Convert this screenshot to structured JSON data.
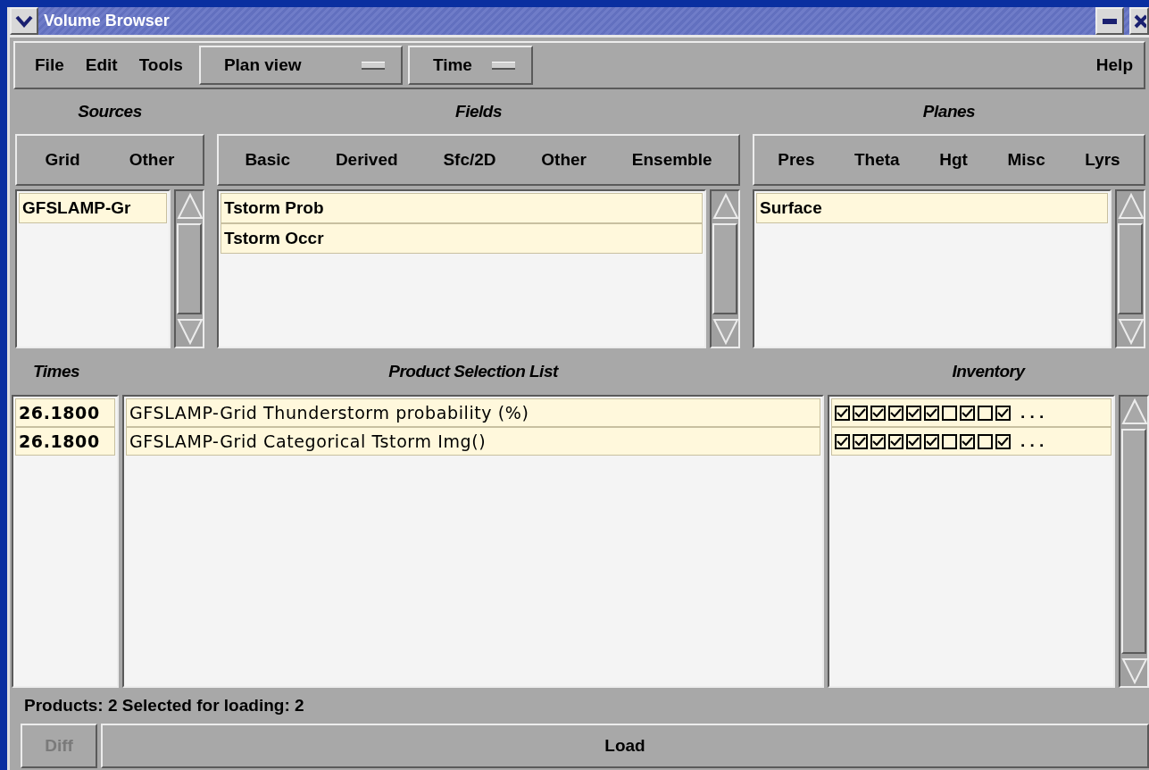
{
  "window": {
    "title": "Volume Browser"
  },
  "menu": [
    "File",
    "Edit",
    "Tools"
  ],
  "dropdowns": [
    "Plan view",
    "Time"
  ],
  "help": "Help",
  "sources": {
    "title": "Sources",
    "tabs": [
      "Grid",
      "Other"
    ],
    "items": [
      {
        "label": "GFSLAMP-Gr",
        "selected": true
      }
    ]
  },
  "fields": {
    "title": "Fields",
    "tabs": [
      "Basic",
      "Derived",
      "Sfc/2D",
      "Other",
      "Ensemble"
    ],
    "items": [
      {
        "label": "Tstorm Prob",
        "selected": true
      },
      {
        "label": "Tstorm Occr",
        "selected": true
      }
    ]
  },
  "planes": {
    "title": "Planes",
    "tabs": [
      "Pres",
      "Theta",
      "Hgt",
      "Misc",
      "Lyrs"
    ],
    "items": [
      {
        "label": "Surface",
        "selected": true
      }
    ]
  },
  "times": {
    "title": "Times",
    "items": [
      {
        "label": "26.1800",
        "selected": true
      },
      {
        "label": "26.1800",
        "selected": true
      }
    ]
  },
  "products": {
    "title": "Product Selection List",
    "items": [
      {
        "label": "GFSLAMP-Grid Thunderstorm probability (%)",
        "selected": true
      },
      {
        "label": "GFSLAMP-Grid Categorical Tstorm Img()",
        "selected": true
      }
    ]
  },
  "inventory": {
    "title": "Inventory",
    "rows": [
      {
        "selected": true,
        "checks": [
          true,
          true,
          true,
          true,
          true,
          true,
          false,
          true,
          false,
          true
        ],
        "more": ". . ."
      },
      {
        "selected": true,
        "checks": [
          true,
          true,
          true,
          true,
          true,
          true,
          false,
          true,
          false,
          true
        ],
        "more": ". . ."
      }
    ]
  },
  "status": "Products: 2  Selected for loading: 2",
  "buttons": [
    {
      "label": "Diff",
      "disabled": true
    },
    {
      "label": "Load",
      "disabled": false
    }
  ]
}
